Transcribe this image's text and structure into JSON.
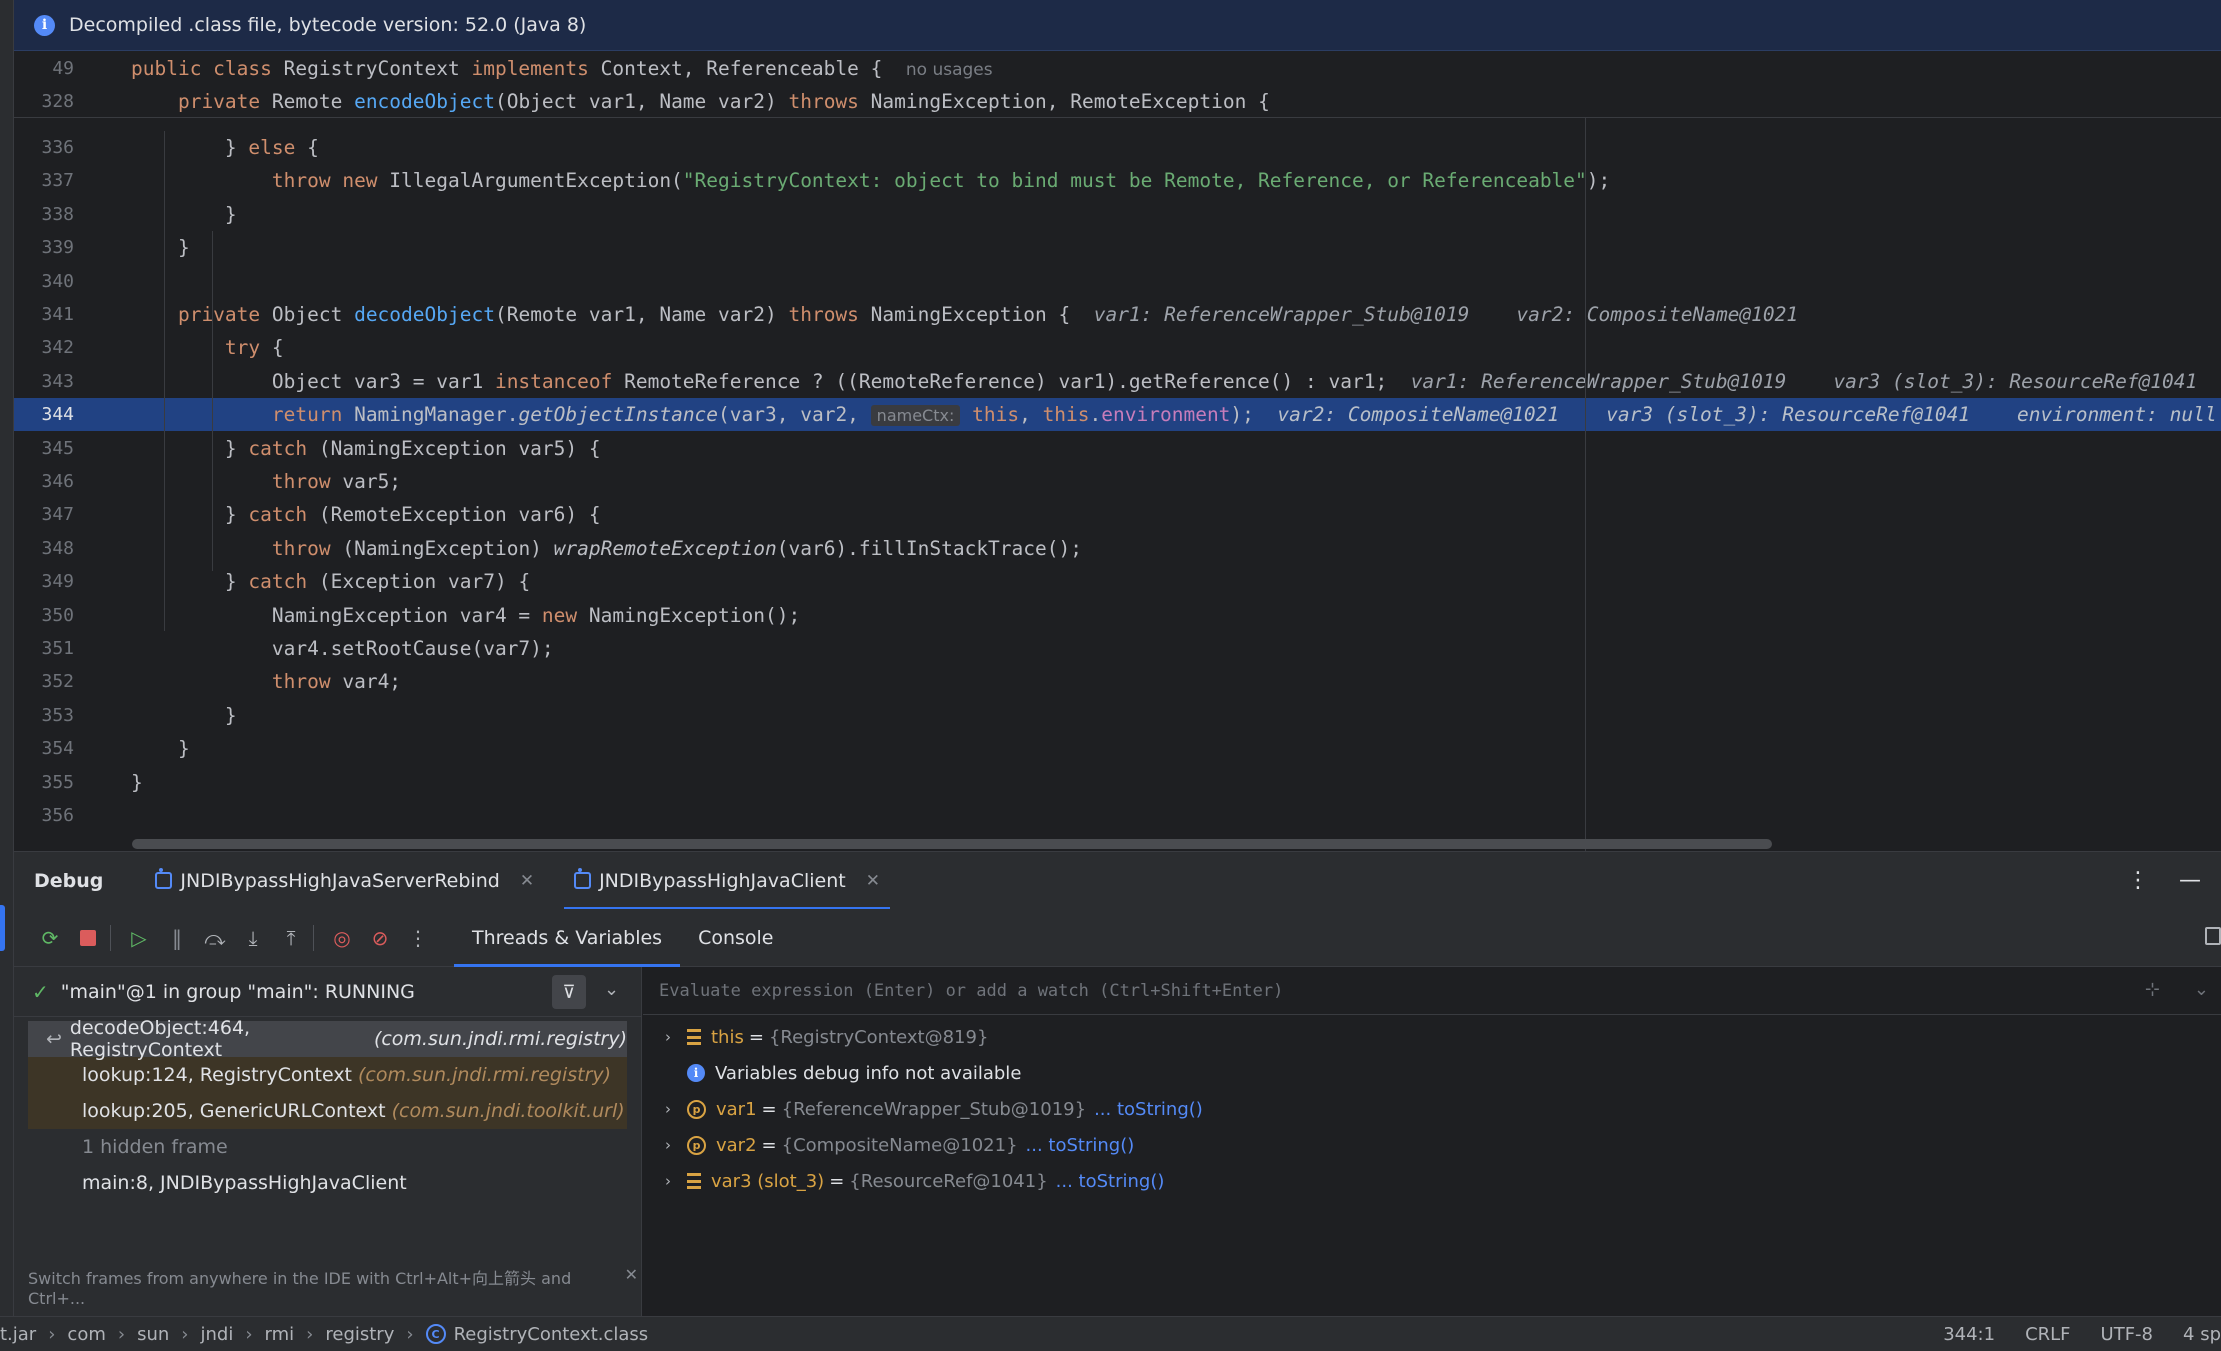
{
  "banner": {
    "text": "Decompiled .class file, bytecode version: 52.0 (Java 8)"
  },
  "editor": {
    "sticky": [
      {
        "ln": "49",
        "tokens": [
          {
            "t": "public class ",
            "c": "kw"
          },
          {
            "t": "RegistryContext "
          },
          {
            "t": "implements ",
            "c": "kw"
          },
          {
            "t": "Context, Referenceable {  "
          },
          {
            "t": "no usages",
            "c": "hint"
          }
        ]
      },
      {
        "ln": "328",
        "tokens": [
          {
            "t": "    private ",
            "c": "kw"
          },
          {
            "t": "Remote "
          },
          {
            "t": "encodeObject",
            "c": "fn"
          },
          {
            "t": "(Object var1, Name var2) "
          },
          {
            "t": "throws ",
            "c": "kw"
          },
          {
            "t": "NamingException, RemoteException {"
          }
        ]
      }
    ],
    "lines": [
      {
        "ln": "336",
        "tokens": [
          {
            "t": "        } "
          },
          {
            "t": "else ",
            "c": "kw"
          },
          {
            "t": "{"
          }
        ]
      },
      {
        "ln": "337",
        "tokens": [
          {
            "t": "            "
          },
          {
            "t": "throw new ",
            "c": "kw"
          },
          {
            "t": "IllegalArgumentException("
          },
          {
            "t": "\"RegistryContext: object to bind must be Remote, Reference, or Referenceable\"",
            "c": "str"
          },
          {
            "t": ");"
          }
        ]
      },
      {
        "ln": "338",
        "tokens": [
          {
            "t": "        }"
          }
        ]
      },
      {
        "ln": "339",
        "tokens": [
          {
            "t": "    }"
          }
        ]
      },
      {
        "ln": "340",
        "tokens": []
      },
      {
        "ln": "341",
        "tokens": [
          {
            "t": "    private ",
            "c": "kw"
          },
          {
            "t": "Object "
          },
          {
            "t": "decodeObject",
            "c": "fn"
          },
          {
            "t": "(Remote var1, Name var2) "
          },
          {
            "t": "throws ",
            "c": "kw"
          },
          {
            "t": "NamingException {  "
          },
          {
            "t": "var1: ReferenceWrapper_Stub@1019    var2: CompositeName@1021",
            "c": "inl"
          }
        ]
      },
      {
        "ln": "342",
        "tokens": [
          {
            "t": "        "
          },
          {
            "t": "try ",
            "c": "kw"
          },
          {
            "t": "{"
          }
        ]
      },
      {
        "ln": "343",
        "tokens": [
          {
            "t": "            Object var3 = var1 "
          },
          {
            "t": "instanceof ",
            "c": "kw"
          },
          {
            "t": "RemoteReference ? ((RemoteReference) var1).getReference() : var1;  "
          },
          {
            "t": "var1: ReferenceWrapper_Stub@1019    var3 (slot_3): ResourceRef@1041",
            "c": "inl"
          }
        ]
      },
      {
        "ln": "344",
        "current": true,
        "tokens": [
          {
            "t": "            "
          },
          {
            "t": "return ",
            "c": "kw"
          },
          {
            "t": "NamingManager."
          },
          {
            "t": "getObjectInstance",
            "c": "it"
          },
          {
            "t": "(var3, var2, "
          },
          {
            "t": "nameCtx:",
            "c": "chip"
          },
          {
            "t": " "
          },
          {
            "t": "this",
            "c": "kw"
          },
          {
            "t": ", "
          },
          {
            "t": "this",
            "c": "kw"
          },
          {
            "t": "."
          },
          {
            "t": "environment",
            "c": "fld"
          },
          {
            "t": ");  "
          },
          {
            "t": "var2: CompositeName@1021    var3 (slot_3): ResourceRef@1041    environment: null",
            "c": "inl"
          }
        ]
      },
      {
        "ln": "345",
        "tokens": [
          {
            "t": "        } "
          },
          {
            "t": "catch ",
            "c": "kw"
          },
          {
            "t": "(NamingException var5) {"
          }
        ]
      },
      {
        "ln": "346",
        "tokens": [
          {
            "t": "            "
          },
          {
            "t": "throw ",
            "c": "kw"
          },
          {
            "t": "var5;"
          }
        ]
      },
      {
        "ln": "347",
        "tokens": [
          {
            "t": "        } "
          },
          {
            "t": "catch ",
            "c": "kw"
          },
          {
            "t": "(RemoteException var6) {"
          }
        ]
      },
      {
        "ln": "348",
        "tokens": [
          {
            "t": "            "
          },
          {
            "t": "throw ",
            "c": "kw"
          },
          {
            "t": "(NamingException) "
          },
          {
            "t": "wrapRemoteException",
            "c": "it"
          },
          {
            "t": "(var6).fillInStackTrace();"
          }
        ]
      },
      {
        "ln": "349",
        "tokens": [
          {
            "t": "        } "
          },
          {
            "t": "catch ",
            "c": "kw"
          },
          {
            "t": "(Exception var7) {"
          }
        ]
      },
      {
        "ln": "350",
        "tokens": [
          {
            "t": "            NamingException var4 = "
          },
          {
            "t": "new ",
            "c": "kw"
          },
          {
            "t": "NamingException();"
          }
        ]
      },
      {
        "ln": "351",
        "tokens": [
          {
            "t": "            var4.setRootCause(var7);"
          }
        ]
      },
      {
        "ln": "352",
        "tokens": [
          {
            "t": "            "
          },
          {
            "t": "throw ",
            "c": "kw"
          },
          {
            "t": "var4;"
          }
        ]
      },
      {
        "ln": "353",
        "tokens": [
          {
            "t": "        }"
          }
        ]
      },
      {
        "ln": "354",
        "tokens": [
          {
            "t": "    }"
          }
        ]
      },
      {
        "ln": "355",
        "tokens": [
          {
            "t": "}"
          }
        ]
      },
      {
        "ln": "356",
        "tokens": []
      }
    ]
  },
  "debug": {
    "title": "Debug",
    "tabs": [
      {
        "label": "JNDIBypassHighJavaServerRebind",
        "active": false
      },
      {
        "label": "JNDIBypassHighJavaClient",
        "active": true
      }
    ],
    "more_icon": "⋮",
    "minimize_icon": "—",
    "subtabs": [
      "Threads & Variables",
      "Console"
    ],
    "thread": "\"main\"@1 in group \"main\": RUNNING",
    "frames": [
      {
        "method": "decodeObject:464, RegistryContext",
        "pkg": "(com.sun.jndi.rmi.registry)",
        "kind": "first"
      },
      {
        "method": "lookup:124, RegistryContext",
        "pkg": "(com.sun.jndi.rmi.registry)",
        "kind": "lib"
      },
      {
        "method": "lookup:205, GenericURLContext",
        "pkg": "(com.sun.jndi.toolkit.url)",
        "kind": "lib"
      },
      {
        "method": "1 hidden frame",
        "pkg": "",
        "kind": "hidden"
      },
      {
        "method": "main:8, JNDIBypassHighJavaClient",
        "pkg": "",
        "kind": "normal"
      }
    ],
    "tip": "Switch frames from anywhere in the IDE with Ctrl+Alt+向上箭头 and Ctrl+...",
    "tip_close": "✕",
    "eval_placeholder": "Evaluate expression (Enter) or add a watch (Ctrl+Shift+Enter)",
    "variables": [
      {
        "expand": "›",
        "icon": "field",
        "name": "this",
        "value": "{RegistryContext@819}",
        "link": ""
      },
      {
        "expand": "",
        "icon": "info",
        "name": "",
        "value": "",
        "info": "Variables debug info not available",
        "link": ""
      },
      {
        "expand": "›",
        "icon": "param",
        "name": "var1",
        "value": "{ReferenceWrapper_Stub@1019}",
        "link": "... toString()"
      },
      {
        "expand": "›",
        "icon": "param",
        "name": "var2",
        "value": "{CompositeName@1021}",
        "link": "... toString()"
      },
      {
        "expand": "›",
        "icon": "field",
        "name": "var3 (slot_3)",
        "value": "{ResourceRef@1041}",
        "link": "... toString()"
      }
    ]
  },
  "statusbar": {
    "crumbs": [
      "t.jar",
      "com",
      "sun",
      "jndi",
      "rmi",
      "registry"
    ],
    "file": "RegistryContext.class",
    "position": "344:1",
    "line_sep": "CRLF",
    "encoding": "UTF-8",
    "indent": "4 sp"
  }
}
